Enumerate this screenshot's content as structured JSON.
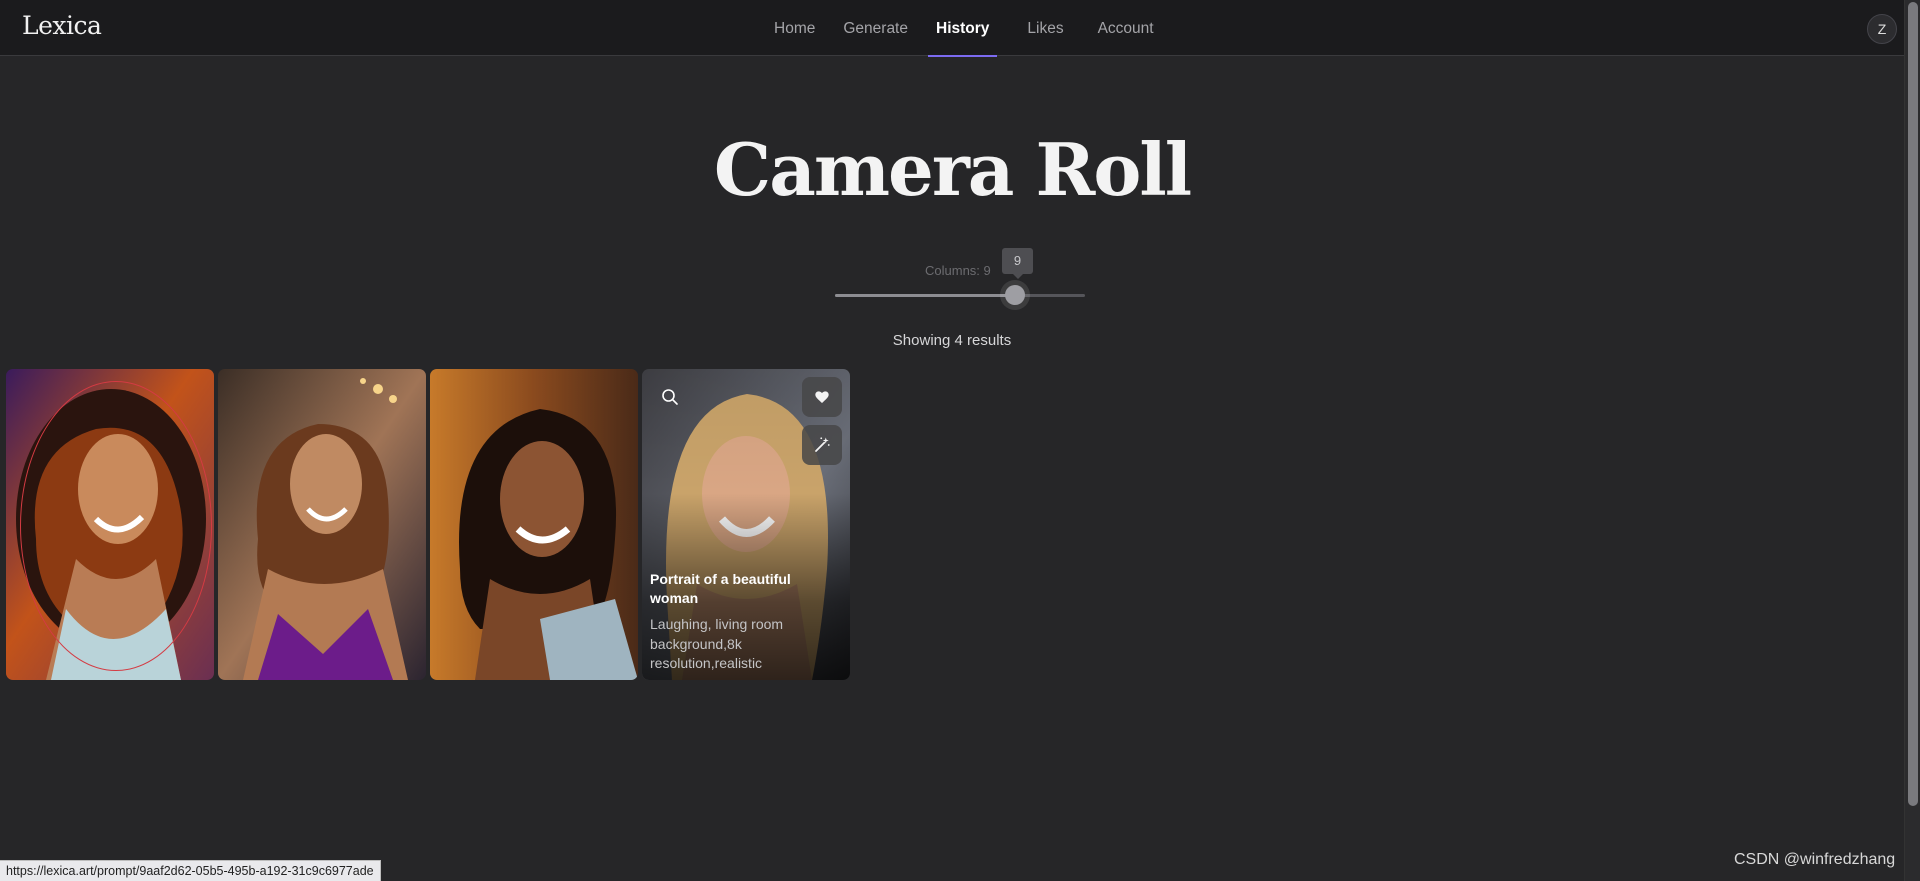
{
  "app": {
    "logo": "Lexica",
    "avatar_initial": "Z"
  },
  "nav": {
    "items": [
      {
        "label": "Home",
        "active": false
      },
      {
        "label": "Generate",
        "active": false
      },
      {
        "label": "History",
        "active": true
      },
      {
        "label": "Likes",
        "active": false
      },
      {
        "label": "Account",
        "active": false
      }
    ]
  },
  "page": {
    "title": "Camera Roll",
    "results_text": "Showing 4 results"
  },
  "columns": {
    "label": "Columns: 9",
    "value": 9,
    "tooltip": "9",
    "fraction": 0.72
  },
  "cards": [
    {
      "id": 1
    },
    {
      "id": 2
    },
    {
      "id": 3
    },
    {
      "id": 4,
      "title": "Portrait of a beautiful woman",
      "description": "Laughing, living room background,8k resolution,realistic",
      "icons": [
        "search-icon",
        "heart-icon",
        "magic-wand-icon"
      ]
    }
  ],
  "status_bar": {
    "url": "https://lexica.art/prompt/9aaf2d62-05b5-495b-a192-31c9c6977ade"
  },
  "watermark": "CSDN @winfredzhang",
  "colors": {
    "accent": "#7c6bf2",
    "background": "#262628",
    "topbar": "#1b1b1d"
  }
}
